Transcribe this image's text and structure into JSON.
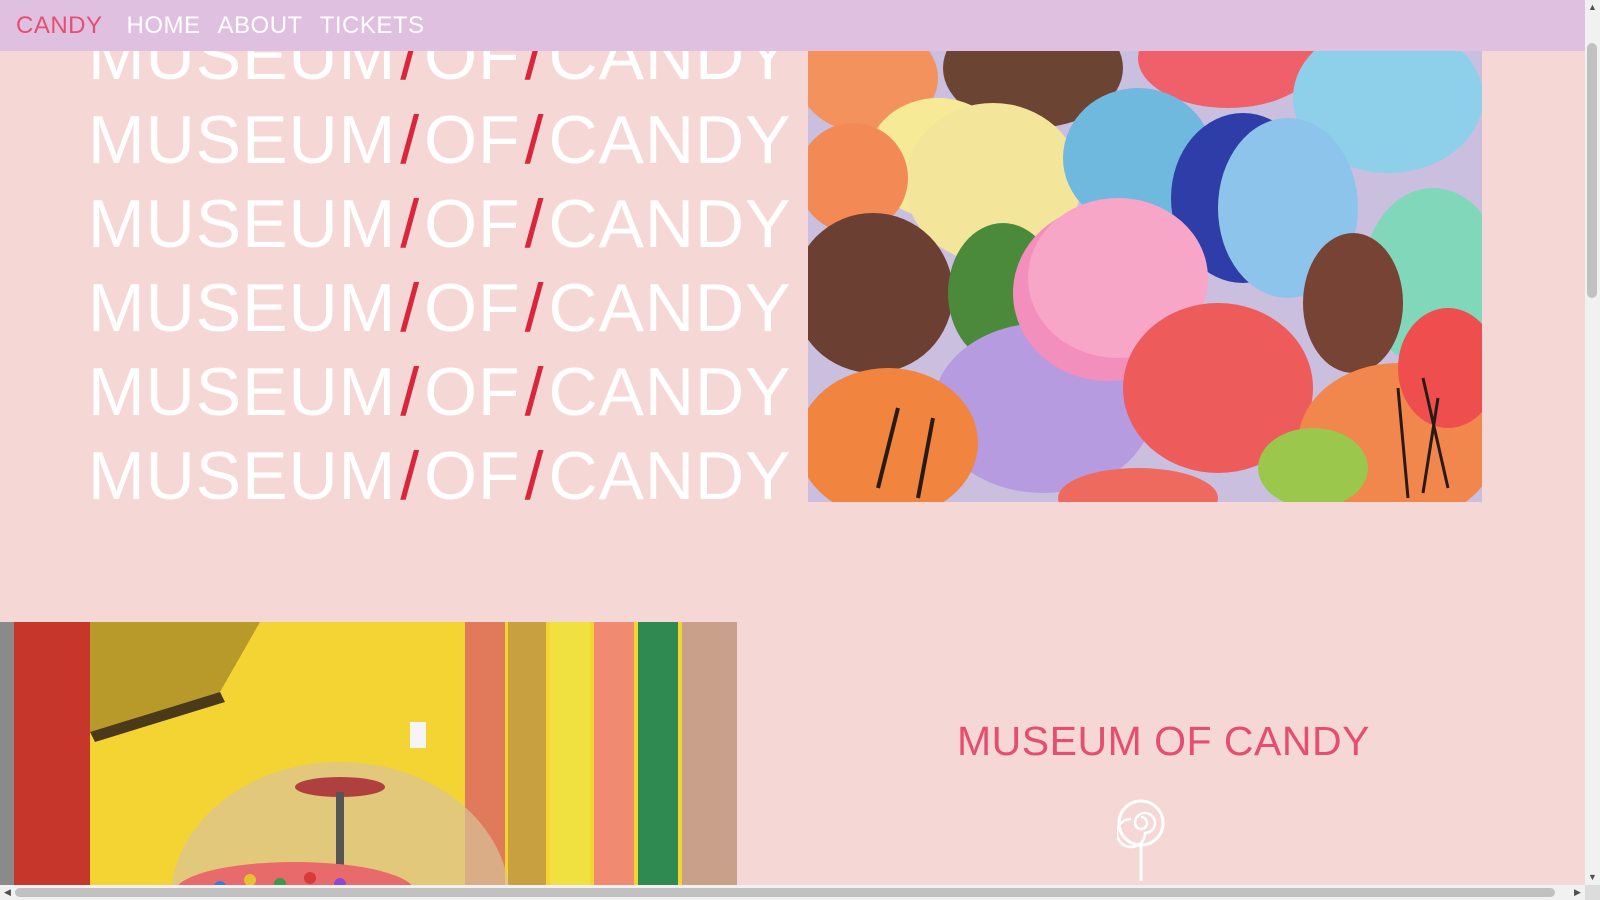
{
  "nav": {
    "brand": "CANDY",
    "links": [
      "HOME",
      "ABOUT",
      "TICKETS"
    ]
  },
  "hero": {
    "word1": "MUSEUM",
    "word2": "OF",
    "word3": "CANDY",
    "separator": "/",
    "repeat_count": 6
  },
  "section": {
    "title": "MUSEUM OF CANDY"
  },
  "images": {
    "macarons": "colorful-macarons-photo",
    "candy_store": "candy-store-dispensers-photo"
  },
  "icons": {
    "lollipop": "lollipop-icon"
  },
  "colors": {
    "background": "#f5d8d6",
    "nav_background": "#e0c0e0",
    "accent": "#e64e6f",
    "slash": "#d8263a",
    "title_text": "#ffffff"
  },
  "scrollbar": {
    "up": "▲",
    "down": "▼",
    "left": "◀",
    "right": "▶"
  }
}
